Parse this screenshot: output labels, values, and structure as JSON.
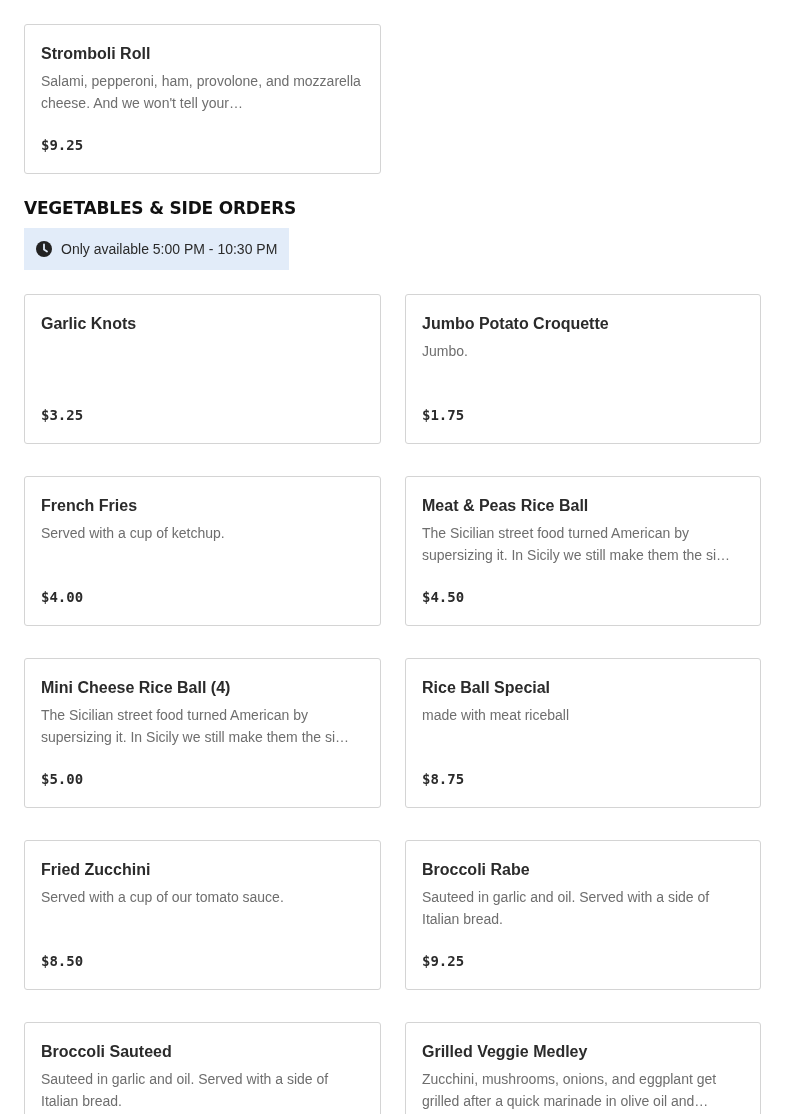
{
  "sections": [
    {
      "items": [
        {
          "name": "Stromboli Roll",
          "description": "Salami, pepperoni, ham, provolone, and mozzarella cheese. And we won't tell your…",
          "price": "$9.25"
        }
      ]
    },
    {
      "heading": "VEGETABLES & SIDE ORDERS",
      "availability": "Only available 5:00 PM - 10:30 PM",
      "items": [
        {
          "name": "Garlic Knots",
          "price": "$3.25"
        },
        {
          "name": "Jumbo Potato Croquette",
          "description": "Jumbo.",
          "price": "$1.75"
        },
        {
          "name": "French Fries",
          "description": "Served with a cup of ketchup.",
          "price": "$4.00"
        },
        {
          "name": "Meat & Peas Rice Ball",
          "description": "The Sicilian street food turned American by supersizing it. In Sicily we still make them the si…",
          "price": "$4.50"
        },
        {
          "name": "Mini Cheese Rice Ball (4)",
          "description": "The Sicilian street food turned American by supersizing it. In Sicily we still make them the si…",
          "price": "$5.00"
        },
        {
          "name": "Rice Ball Special",
          "description": "made with meat riceball",
          "price": "$8.75"
        },
        {
          "name": "Fried Zucchini",
          "description": "Served with a cup of our tomato sauce.",
          "price": "$8.50"
        },
        {
          "name": "Broccoli Rabe",
          "description": "Sauteed in garlic and oil. Served with a side of Italian bread.",
          "price": "$9.25"
        },
        {
          "name": "Broccoli Sauteed",
          "description": "Sauteed in garlic and oil. Served with a side of Italian bread."
        },
        {
          "name": "Grilled Veggie Medley",
          "description": "Zucchini, mushrooms, onions, and eggplant get grilled after a quick marinade in olive oil and…"
        }
      ]
    }
  ]
}
